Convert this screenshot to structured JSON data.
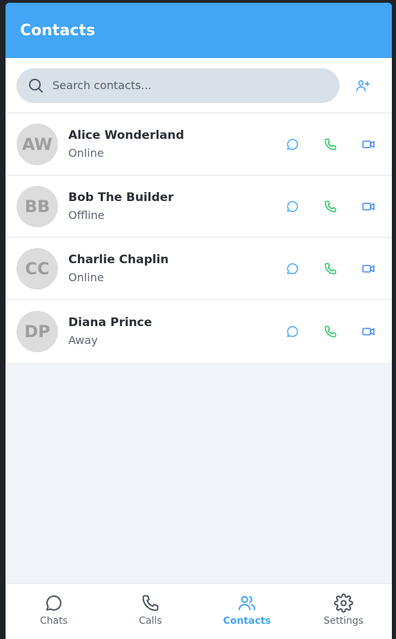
{
  "header": {
    "title": "Contacts"
  },
  "search": {
    "placeholder": "Search contacts..."
  },
  "contacts": [
    {
      "initials": "AW",
      "name": "Alice Wonderland",
      "status": "Online"
    },
    {
      "initials": "BB",
      "name": "Bob The Builder",
      "status": "Offline"
    },
    {
      "initials": "CC",
      "name": "Charlie Chaplin",
      "status": "Online"
    },
    {
      "initials": "DP",
      "name": "Diana Prince",
      "status": "Away"
    }
  ],
  "nav": [
    {
      "label": "Chats",
      "icon": "chat-icon"
    },
    {
      "label": "Calls",
      "icon": "phone-icon"
    },
    {
      "label": "Contacts",
      "icon": "users-icon",
      "active": true
    },
    {
      "label": "Settings",
      "icon": "gear-icon"
    }
  ],
  "colors": {
    "accent": "#42a5f5",
    "chat_action": "#42a5f5",
    "call_action": "#22c55e",
    "video_action": "#3b82f6"
  }
}
